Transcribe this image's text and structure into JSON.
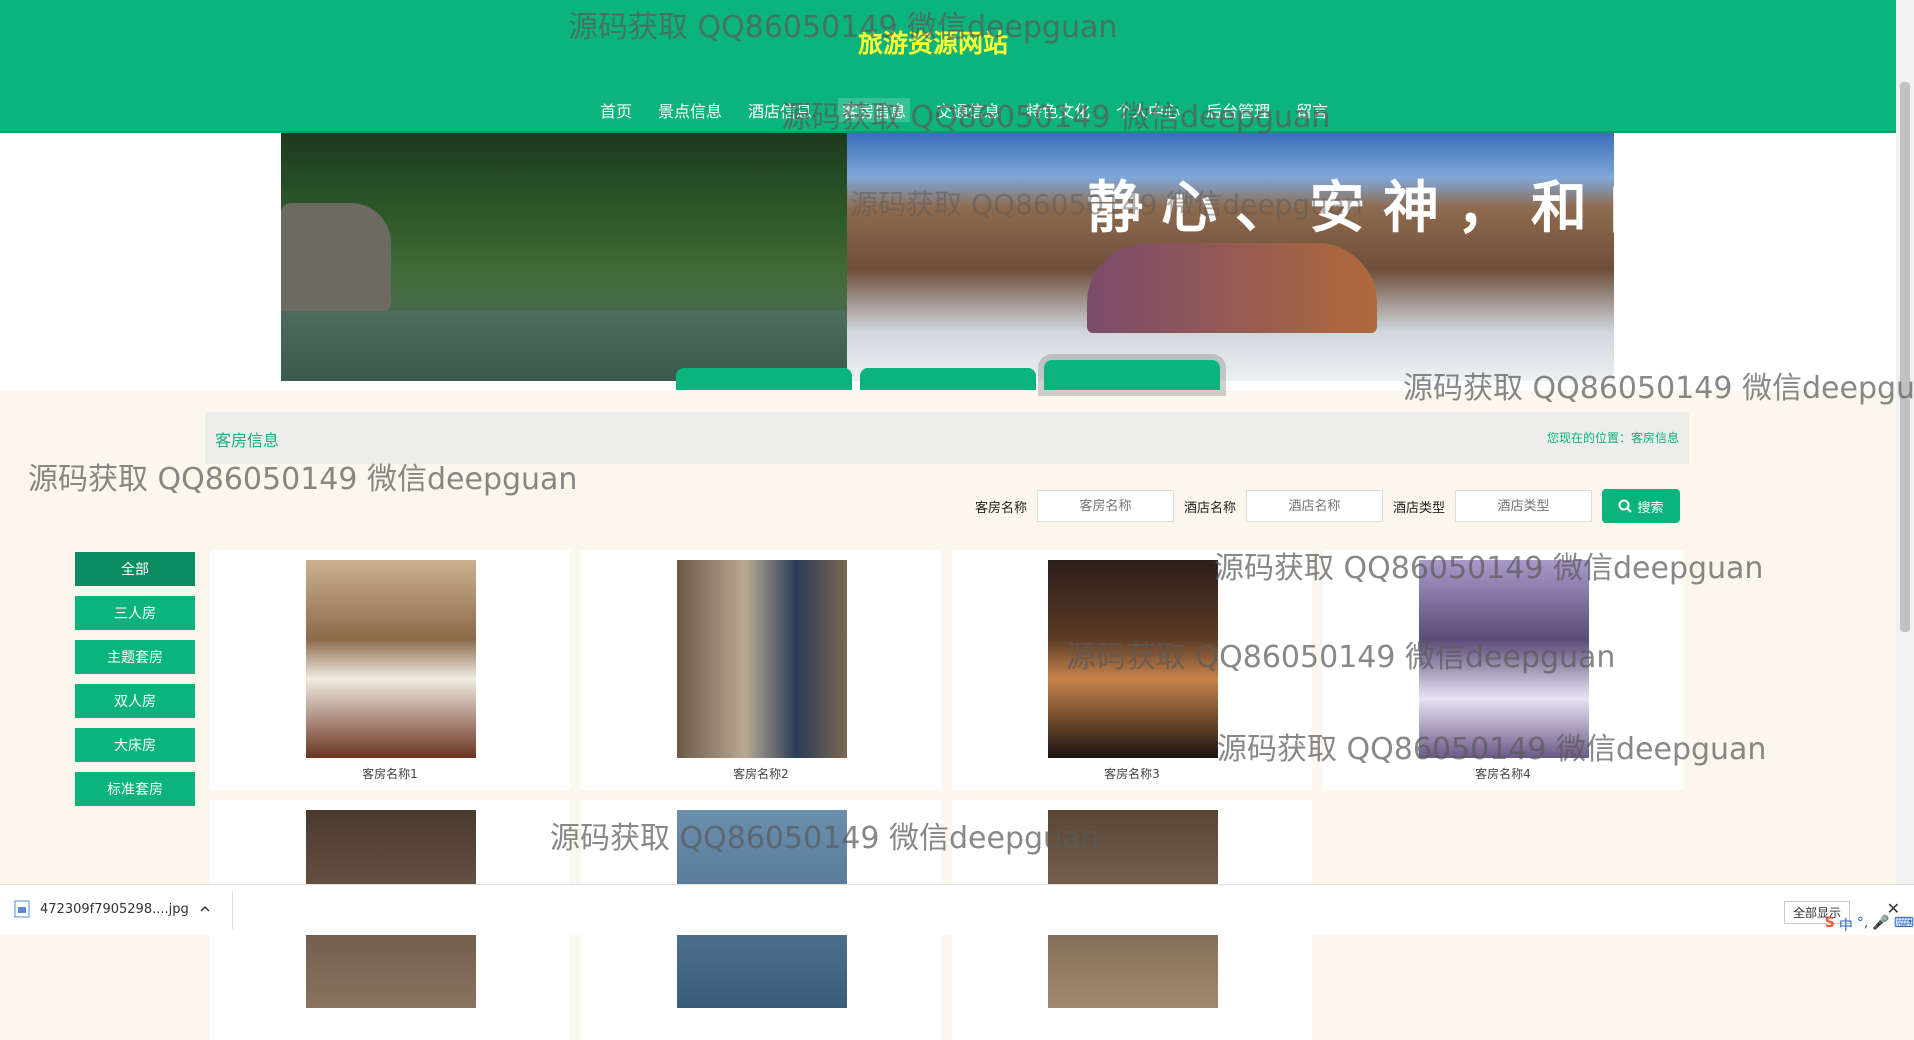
{
  "header": {
    "title": "旅游资源网站",
    "nav": [
      "首页",
      "景点信息",
      "酒店信息",
      "客房信息",
      "交通信息",
      "特色文化",
      "个人中心",
      "后台管理",
      "留言"
    ],
    "active_index": 3
  },
  "banner": {
    "calligraphy": "静心、安神，和自",
    "active_dot": 2
  },
  "breadcrumb": {
    "title": "客房信息",
    "location_prefix": "您现在的位置：",
    "location": "客房信息"
  },
  "search": {
    "fields": [
      {
        "label": "客房名称",
        "placeholder": "客房名称"
      },
      {
        "label": "酒店名称",
        "placeholder": "酒店名称"
      },
      {
        "label": "酒店类型",
        "placeholder": "酒店类型"
      }
    ],
    "button": "搜索"
  },
  "categories": [
    "全部",
    "三人房",
    "主题套房",
    "双人房",
    "大床房",
    "标准套房"
  ],
  "rooms": [
    {
      "name": "客房名称1"
    },
    {
      "name": "客房名称2"
    },
    {
      "name": "客房名称3"
    },
    {
      "name": "客房名称4"
    },
    {
      "name": ""
    },
    {
      "name": ""
    },
    {
      "name": ""
    }
  ],
  "watermark": "源码获取 QQ86050149 微信deepguan",
  "download": {
    "filename": "472309f7905298....jpg",
    "show_all": "全部显示"
  },
  "tray": [
    "中",
    "°,",
    "🎤",
    "⌨"
  ],
  "colors": {
    "brand": "#0bb47d",
    "title": "#ffff33",
    "page_bg": "#fbf7ec"
  }
}
